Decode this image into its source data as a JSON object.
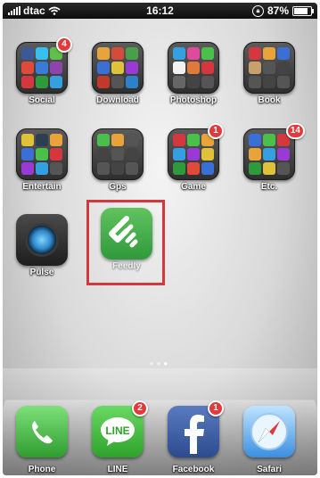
{
  "status_bar": {
    "carrier": "dtac",
    "time": "16:12",
    "battery": "87%"
  },
  "home_apps": [
    {
      "label": "Social",
      "badge": "4",
      "kind": "folder"
    },
    {
      "label": "Download",
      "badge": "",
      "kind": "folder"
    },
    {
      "label": "Photoshop",
      "badge": "",
      "kind": "folder"
    },
    {
      "label": "Book",
      "badge": "",
      "kind": "folder"
    },
    {
      "label": "Entertain",
      "badge": "",
      "kind": "folder"
    },
    {
      "label": "Gps",
      "badge": "",
      "kind": "folder"
    },
    {
      "label": "Game",
      "badge": "1",
      "kind": "folder"
    },
    {
      "label": "Etc.",
      "badge": "14",
      "kind": "folder"
    },
    {
      "label": "Pulse",
      "badge": "",
      "kind": "app"
    },
    {
      "label": "Feedly",
      "badge": "",
      "kind": "app"
    }
  ],
  "page_dots": {
    "count": 3,
    "active_index": 2
  },
  "dock": [
    {
      "label": "Phone",
      "badge": ""
    },
    {
      "label": "LINE",
      "badge": "2"
    },
    {
      "label": "Facebook",
      "badge": "1"
    },
    {
      "label": "Safari",
      "badge": ""
    }
  ],
  "icons": {
    "pulse": "pulse-app-icon",
    "feedly": "feedly-app-icon",
    "phone": "phone-handset-icon",
    "line": "line-chat-bubble-icon",
    "facebook": "facebook-f-icon",
    "safari": "safari-compass-icon"
  },
  "colors": {
    "badge": "#e23a3a",
    "highlight": "#d4373e",
    "feedly": "#3aa64a"
  }
}
